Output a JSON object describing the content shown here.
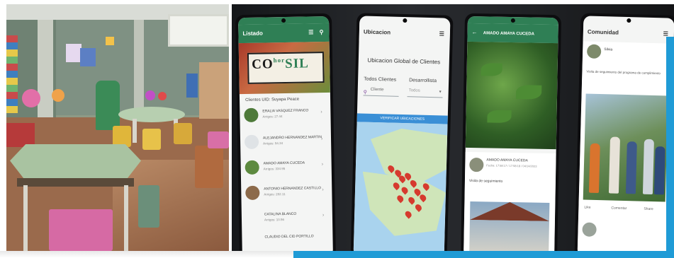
{
  "colors": {
    "app_green": "#2f7f55",
    "accent_blue": "#1f9bd6",
    "map_water": "#a9d3ee",
    "pin_red": "#d63a2e"
  },
  "phone1": {
    "appbar_title": "Listado",
    "logo_co": "CO",
    "logo_hor": "hor",
    "logo_sil": "SIL",
    "list_header": "Clientes UID: Suyapa Peace",
    "items": [
      {
        "name": "ERALIA VASQUEZ FRANCO",
        "sub": "Arrigos: 27.44"
      },
      {
        "name": "ALEJANDRO HERNANDEZ MARTIN",
        "sub": "Arrigos: 94.34"
      },
      {
        "name": "AMADO AMAYA CUCEDA",
        "sub": "Arrigos: 334.95"
      },
      {
        "name": "ANTONIO HERNANDEZ CASTILLO",
        "sub": "Arrigos: 282.11"
      },
      {
        "name": "CATALINA BLANCO",
        "sub": "Arrigos: 10.56"
      },
      {
        "name": "CLAUDIO DEL CID PORTILLO",
        "sub": ""
      }
    ]
  },
  "phone2": {
    "appbar_title": "Ubicacion",
    "heading": "Ubicacion Global de Clientes",
    "label_left": "Todos Clientes",
    "label_right": "Desarrollista",
    "select_left": "Cliente",
    "select_right": "Todos",
    "button": "VERIFICAR UBICACIONES"
  },
  "phone3": {
    "appbar_title": "AMADO AMAYA CUCEDA",
    "post_author": "AMADO AMAYA CUCEDA",
    "post_date": "Fecha: 17:58:17 / 17:58:18 / 04/14/2023",
    "post_text": "Visita de seguimiento"
  },
  "phone4": {
    "appbar_title": "Comunidad",
    "post_author": "Silvia",
    "post_text": "Visita de seguimiento del programa de cumplimiento",
    "action_like": "Like",
    "action_comment": "Comentar",
    "action_share": "Share"
  }
}
